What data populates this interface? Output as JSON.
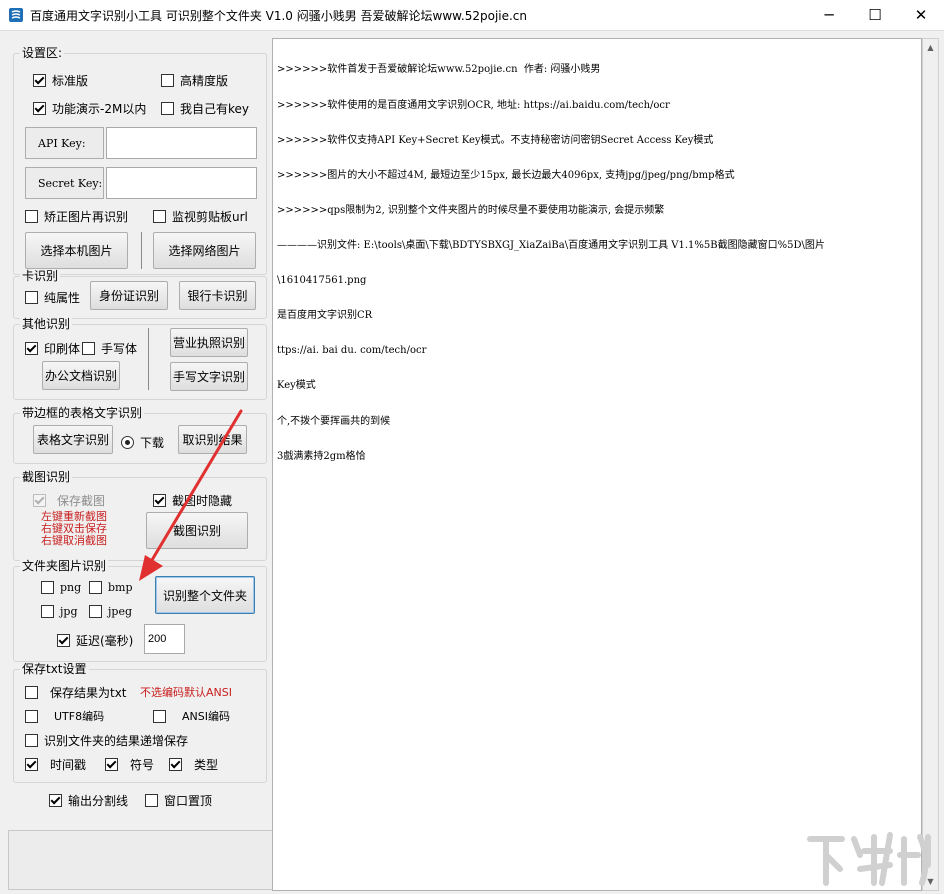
{
  "window": {
    "title": "百度通用文字识别小工具 可识别整个文件夹 V1.0  闷骚小贱男    吾爱破解论坛www.52pojie.cn",
    "controls": {
      "minimize": "─",
      "maximize": "☐",
      "close": "✕"
    }
  },
  "settings": {
    "group_title": "设置区:",
    "standard": {
      "label": "标准版",
      "checked": true
    },
    "high_precision": {
      "label": "高精度版",
      "checked": false
    },
    "demo_mode": {
      "label": "功能演示-2M以内",
      "checked": true
    },
    "own_key": {
      "label": "我自己有key",
      "checked": false
    },
    "api_key_label": "API Key:",
    "api_key_value": "",
    "secret_key_label": "Secret Key:",
    "secret_key_value": "",
    "correct_image": {
      "label": "矫正图片再识别",
      "checked": false
    },
    "monitor_clipboard": {
      "label": "监视剪贴板url",
      "checked": false
    },
    "select_local_button": "选择本机图片",
    "select_web_button": "选择网络图片"
  },
  "card": {
    "group_title": "卡识别",
    "pure_attr": {
      "label": "纯属性",
      "checked": false
    },
    "id_card_button": "身份证识别",
    "bank_card_button": "银行卡识别"
  },
  "other": {
    "group_title": "其他识别",
    "printed": {
      "label": "印刷体",
      "checked": true
    },
    "handwritten": {
      "label": "手写体",
      "checked": false
    },
    "office_doc_button": "办公文档识别",
    "business_license_button": "营业执照识别",
    "handwriting_button": "手写文字识别"
  },
  "table": {
    "group_title": "带边框的表格文字识别",
    "table_button": "表格文字识别",
    "download_radio": "下载",
    "fetch_result_button": "取识别结果"
  },
  "screenshot": {
    "group_title": "截图识别",
    "save_screenshot": {
      "label": "保存截图",
      "checked": true,
      "disabled": true
    },
    "hide_on_capture": {
      "label": "截图时隐藏",
      "checked": true
    },
    "hint_lines": [
      "左键重新截图",
      "右键双击保存",
      "右键取消截图"
    ],
    "capture_button": "截图识别"
  },
  "folder": {
    "group_title": "文件夹图片识别",
    "png": {
      "label": "png",
      "checked": false
    },
    "bmp": {
      "label": "bmp",
      "checked": false
    },
    "jpg": {
      "label": "jpg",
      "checked": false
    },
    "jpeg": {
      "label": "jpeg",
      "checked": false
    },
    "delay": {
      "label": "延迟(毫秒)",
      "checked": true
    },
    "delay_value": "200",
    "recognize_folder_button": "识别整个文件夹"
  },
  "save_txt": {
    "group_title": "保存txt设置",
    "save_as_txt": {
      "label": "保存结果为txt",
      "checked": false
    },
    "encoding_hint": "不选编码默认ANSI",
    "utf8": {
      "label": "UTF8编码",
      "checked": false
    },
    "ansi": {
      "label": "ANSI编码",
      "checked": false
    },
    "incremental": {
      "label": "识别文件夹的结果递增保存",
      "checked": false
    },
    "timestamp": {
      "label": "时间戳",
      "checked": true
    },
    "symbol": {
      "label": "符号",
      "checked": true
    },
    "type": {
      "label": "类型",
      "checked": true
    }
  },
  "bottom": {
    "output_divider": {
      "label": "输出分割线",
      "checked": true
    },
    "topmost": {
      "label": "窗口置顶",
      "checked": false
    }
  },
  "log": {
    "lines": [
      ">>>>>>软件首发于吾爱破解论坛www.52pojie.cn  作者: 闷骚小贱男",
      ">>>>>>软件使用的是百度通用文字识别OCR, 地址: https://ai.baidu.com/tech/ocr",
      ">>>>>>软件仅支持API Key+Secret Key模式。不支持秘密访问密钥Secret Access Key模式",
      ">>>>>>图片的大小不超过4M, 最短边至少15px, 最长边最大4096px, 支持jpg/jpeg/png/bmp格式",
      ">>>>>>qps限制为2, 识别整个文件夹图片的时候尽量不要使用功能演示, 会提示频繁",
      "————识别文件: E:\\tools\\桌面\\下载\\BDTYSBXGJ_XiaZaiBa\\百度通用文字识别工具 V1.1%5B截图隐藏窗口%5D\\图片",
      "\\1610417561.png",
      "是百度用文字识别CR",
      "ttps://ai. bai du. com/tech/ocr",
      "Key模式",
      "个,不拨个要挥画共的到候",
      "3戲满素持2gm格恰"
    ]
  },
  "colors": {
    "accent_arrow": "#e03030",
    "hint_red": "#c81e1e",
    "focus_border": "#3c7fb1"
  }
}
